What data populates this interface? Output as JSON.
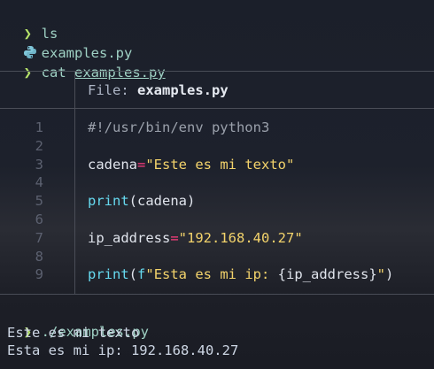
{
  "terminal": {
    "prompt_symbol": "❯",
    "commands": [
      {
        "cmd": "ls"
      },
      {
        "cmd": "cat ",
        "arg": "examples.py"
      },
      {
        "cmd": "./examples.py"
      }
    ],
    "ls_output": {
      "file": "examples.py",
      "icon": "python-icon"
    },
    "program_output": [
      "Este es mi texto",
      "Esta es mi ip: 192.168.40.27"
    ]
  },
  "viewer": {
    "file_label": "File: ",
    "file_name": "examples.py",
    "line_numbers": [
      "1",
      "2",
      "3",
      "4",
      "5",
      "6",
      "7",
      "8",
      "9"
    ],
    "lines": [
      {
        "parts": [
          {
            "t": "#!/usr/bin/env python3",
            "c": "comment"
          }
        ]
      },
      {
        "parts": []
      },
      {
        "parts": [
          {
            "t": "cadena",
            "c": "plain"
          },
          {
            "t": "=",
            "c": "op"
          },
          {
            "t": "\"Este es mi texto\"",
            "c": "str"
          }
        ]
      },
      {
        "parts": []
      },
      {
        "parts": [
          {
            "t": "print",
            "c": "fn"
          },
          {
            "t": "(cadena)",
            "c": "plain"
          }
        ]
      },
      {
        "parts": []
      },
      {
        "parts": [
          {
            "t": "ip_address",
            "c": "plain"
          },
          {
            "t": "=",
            "c": "op"
          },
          {
            "t": "\"192.168.40.27\"",
            "c": "str"
          }
        ]
      },
      {
        "parts": []
      },
      {
        "parts": [
          {
            "t": "print",
            "c": "fn"
          },
          {
            "t": "(",
            "c": "plain"
          },
          {
            "t": "f",
            "c": "f"
          },
          {
            "t": "\"Esta es mi ip: ",
            "c": "str"
          },
          {
            "t": "{ip_address}",
            "c": "plain"
          },
          {
            "t": "\"",
            "c": "str"
          },
          {
            "t": ")",
            "c": "plain"
          }
        ]
      }
    ]
  },
  "colors": {
    "prompt": "#b6e36a",
    "command": "#9fd1c4",
    "string": "#f3d36b",
    "operator": "#ff3d7f",
    "function": "#66d9ef"
  }
}
